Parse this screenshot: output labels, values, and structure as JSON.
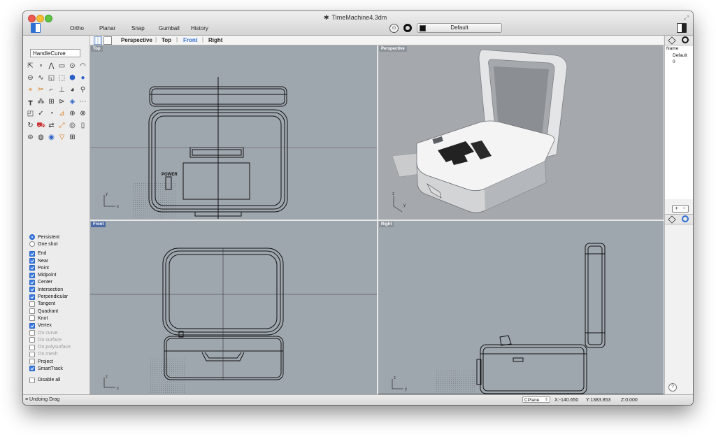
{
  "window": {
    "title": "TimeMachine4.3dm",
    "file_glyph": "✱"
  },
  "toolbar": {
    "items": [
      "Ortho",
      "Planar",
      "Snap",
      "Gumball",
      "History"
    ],
    "layer": "Default"
  },
  "sidebar": {
    "command": "HandleCurve",
    "snap_mode": [
      "Persistent",
      "One shot"
    ],
    "snaps": [
      {
        "label": "End",
        "checked": true,
        "enabled": true
      },
      {
        "label": "Near",
        "checked": true,
        "enabled": true
      },
      {
        "label": "Point",
        "checked": true,
        "enabled": true
      },
      {
        "label": "Midpoint",
        "checked": true,
        "enabled": true
      },
      {
        "label": "Center",
        "checked": true,
        "enabled": true
      },
      {
        "label": "Intersection",
        "checked": true,
        "enabled": true
      },
      {
        "label": "Perpendicular",
        "checked": true,
        "enabled": true
      },
      {
        "label": "Tangent",
        "checked": false,
        "enabled": true
      },
      {
        "label": "Quadrant",
        "checked": false,
        "enabled": true
      },
      {
        "label": "Knot",
        "checked": false,
        "enabled": true
      },
      {
        "label": "Vertex",
        "checked": true,
        "enabled": true
      },
      {
        "label": "On curve",
        "checked": false,
        "enabled": false
      },
      {
        "label": "On surface",
        "checked": false,
        "enabled": false
      },
      {
        "label": "On polysurface",
        "checked": false,
        "enabled": false
      },
      {
        "label": "On mesh",
        "checked": false,
        "enabled": false
      },
      {
        "label": "Project",
        "checked": false,
        "enabled": true
      },
      {
        "label": "SmartTrack",
        "checked": true,
        "enabled": true
      }
    ],
    "disable_all": "Disable all",
    "tools": [
      {
        "name": "select-arrow",
        "glyph": "⇱",
        "tone": ""
      },
      {
        "name": "point",
        "glyph": "∘",
        "tone": ""
      },
      {
        "name": "polyline",
        "glyph": "⋀",
        "tone": ""
      },
      {
        "name": "rectangle",
        "glyph": "▭",
        "tone": ""
      },
      {
        "name": "circle",
        "glyph": "⊙",
        "tone": ""
      },
      {
        "name": "arc",
        "glyph": "◠",
        "tone": ""
      },
      {
        "name": "ellipse",
        "glyph": "⊖",
        "tone": ""
      },
      {
        "name": "curve",
        "glyph": "∿",
        "tone": ""
      },
      {
        "name": "surface",
        "glyph": "◱",
        "tone": ""
      },
      {
        "name": "extrude",
        "glyph": "⬚",
        "tone": ""
      },
      {
        "name": "solid",
        "glyph": "⬢",
        "tone": "c-blue"
      },
      {
        "name": "sphere",
        "glyph": "●",
        "tone": "c-blue"
      },
      {
        "name": "transform",
        "glyph": "⌖",
        "tone": "c-orange"
      },
      {
        "name": "boolean",
        "glyph": "✂",
        "tone": "c-orange"
      },
      {
        "name": "fillet",
        "glyph": "⌐",
        "tone": ""
      },
      {
        "name": "trim",
        "glyph": "⊥",
        "tone": ""
      },
      {
        "name": "render",
        "glyph": "◕",
        "tone": ""
      },
      {
        "name": "analyze",
        "glyph": "⚲",
        "tone": ""
      },
      {
        "name": "dimension",
        "glyph": "┳",
        "tone": ""
      },
      {
        "name": "explode",
        "glyph": "⁂",
        "tone": ""
      },
      {
        "name": "group",
        "glyph": "⊞",
        "tone": ""
      },
      {
        "name": "mirror",
        "glyph": "⊳",
        "tone": ""
      },
      {
        "name": "mesh",
        "glyph": "◈",
        "tone": "c-blue"
      },
      {
        "name": "measure",
        "glyph": "⋯",
        "tone": ""
      },
      {
        "name": "array",
        "glyph": "◰",
        "tone": ""
      },
      {
        "name": "check",
        "glyph": "✓",
        "tone": ""
      },
      {
        "name": "layer-tool",
        "glyph": "◔",
        "tone": ""
      },
      {
        "name": "paint",
        "glyph": "⊿",
        "tone": "c-orange"
      },
      {
        "name": "zoom",
        "glyph": "⊕",
        "tone": ""
      },
      {
        "name": "zoom-extents",
        "glyph": "⊗",
        "tone": ""
      },
      {
        "name": "rotate-view",
        "glyph": "↻",
        "tone": ""
      },
      {
        "name": "car",
        "glyph": "⛟",
        "tone": "c-red"
      },
      {
        "name": "move",
        "glyph": "⇄",
        "tone": ""
      },
      {
        "name": "scale",
        "glyph": "⤢",
        "tone": "c-orange"
      },
      {
        "name": "bulb",
        "glyph": "◎",
        "tone": ""
      },
      {
        "name": "doc",
        "glyph": "▯",
        "tone": ""
      },
      {
        "name": "properties",
        "glyph": "⊜",
        "tone": ""
      },
      {
        "name": "material",
        "glyph": "◍",
        "tone": ""
      },
      {
        "name": "render-sphere",
        "glyph": "◉",
        "tone": "c-blue"
      },
      {
        "name": "filter",
        "glyph": "▽",
        "tone": "c-orange"
      },
      {
        "name": "grid-tool",
        "glyph": "⊞",
        "tone": ""
      }
    ]
  },
  "viewtabs": [
    "Perspective",
    "Top",
    "Front",
    "Right"
  ],
  "viewports": {
    "top": {
      "label": "Top",
      "ax": "y",
      "bx": "x",
      "power": "POWER"
    },
    "perspective": {
      "label": "Perspective",
      "ax": "z",
      "bx": "y"
    },
    "front": {
      "label": "Front",
      "ax": "z",
      "bx": "x"
    },
    "right": {
      "label": "Right",
      "ax": "z",
      "bx": "y"
    }
  },
  "layers": {
    "header": "Name",
    "rows": [
      "Default",
      "0"
    ],
    "buttons": [
      "+",
      "−"
    ]
  },
  "status": {
    "message": "Undoing Drag",
    "cplane": "CPlane",
    "x": "X:-140.650",
    "y": "Y:1383.853",
    "z": "Z:0.000"
  },
  "colors": {
    "accent": "#2d6fd3",
    "viewport": "#9fa7ae",
    "active_label": "#4c6aa5"
  }
}
